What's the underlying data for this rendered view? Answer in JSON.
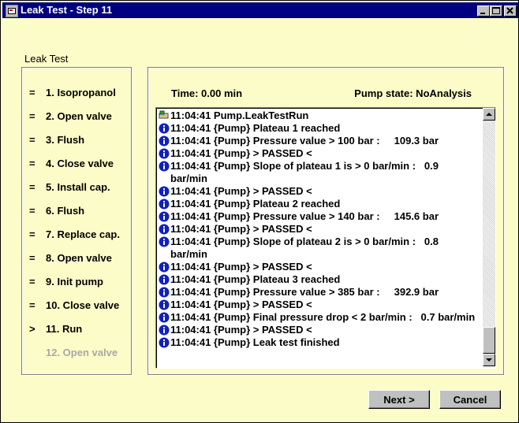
{
  "window": {
    "title": "Leak Test - Step 11"
  },
  "group_label": "Leak Test",
  "steps": [
    {
      "marker": "=",
      "label": "1. Isopropanol",
      "state": "done"
    },
    {
      "marker": "=",
      "label": "2. Open valve",
      "state": "done"
    },
    {
      "marker": "=",
      "label": "3. Flush",
      "state": "done"
    },
    {
      "marker": "=",
      "label": "4. Close valve",
      "state": "done"
    },
    {
      "marker": "=",
      "label": "5. Install cap.",
      "state": "done"
    },
    {
      "marker": "=",
      "label": "6. Flush",
      "state": "done"
    },
    {
      "marker": "=",
      "label": "7. Replace cap.",
      "state": "done"
    },
    {
      "marker": "=",
      "label": "8. Open valve",
      "state": "done"
    },
    {
      "marker": "=",
      "label": "9. Init pump",
      "state": "done"
    },
    {
      "marker": "=",
      "label": "10. Close valve",
      "state": "done"
    },
    {
      "marker": ">",
      "label": "11. Run",
      "state": "current"
    },
    {
      "marker": "",
      "label": "12. Open valve",
      "state": "pending"
    }
  ],
  "status": {
    "time": "Time: 0.00 min",
    "pump_state": "Pump state: NoAnalysis"
  },
  "log": [
    {
      "icon": "pump-icon",
      "text": "11:04:41 Pump.LeakTestRun"
    },
    {
      "icon": "info-icon",
      "text": "11:04:41 {Pump} Plateau 1 reached"
    },
    {
      "icon": "info-icon",
      "text": "11:04:41 {Pump} Pressure value > 100 bar :     109.3 bar"
    },
    {
      "icon": "info-icon",
      "text": "11:04:41 {Pump} > PASSED <"
    },
    {
      "icon": "info-icon",
      "text": "11:04:41 {Pump} Slope of plateau 1 is > 0 bar/min :   0.9"
    },
    {
      "icon": "",
      "text": "bar/min"
    },
    {
      "icon": "info-icon",
      "text": "11:04:41 {Pump} > PASSED <"
    },
    {
      "icon": "info-icon",
      "text": "11:04:41 {Pump} Plateau 2 reached"
    },
    {
      "icon": "info-icon",
      "text": "11:04:41 {Pump} Pressure value > 140 bar :     145.6 bar"
    },
    {
      "icon": "info-icon",
      "text": "11:04:41 {Pump} > PASSED <"
    },
    {
      "icon": "info-icon",
      "text": "11:04:41 {Pump} Slope of plateau 2 is > 0 bar/min :   0.8"
    },
    {
      "icon": "",
      "text": "bar/min"
    },
    {
      "icon": "info-icon",
      "text": "11:04:41 {Pump} > PASSED <"
    },
    {
      "icon": "info-icon",
      "text": "11:04:41 {Pump} Plateau 3 reached"
    },
    {
      "icon": "info-icon",
      "text": "11:04:41 {Pump} Pressure value > 385 bar :     392.9 bar"
    },
    {
      "icon": "info-icon",
      "text": "11:04:41 {Pump} > PASSED <"
    },
    {
      "icon": "info-icon",
      "text": "11:04:41 {Pump} Final pressure drop < 2 bar/min :   0.7 bar/min"
    },
    {
      "icon": "info-icon",
      "text": "11:04:41 {Pump} > PASSED <"
    },
    {
      "icon": "info-icon",
      "text": "11:04:41 {Pump} Leak test finished"
    }
  ],
  "buttons": {
    "next": "Next >",
    "cancel": "Cancel"
  },
  "colors": {
    "background": "#fcfcc8",
    "titlebar": "#000080",
    "info_icon": "#1020c0",
    "disabled_text": "#a8a8a8"
  }
}
